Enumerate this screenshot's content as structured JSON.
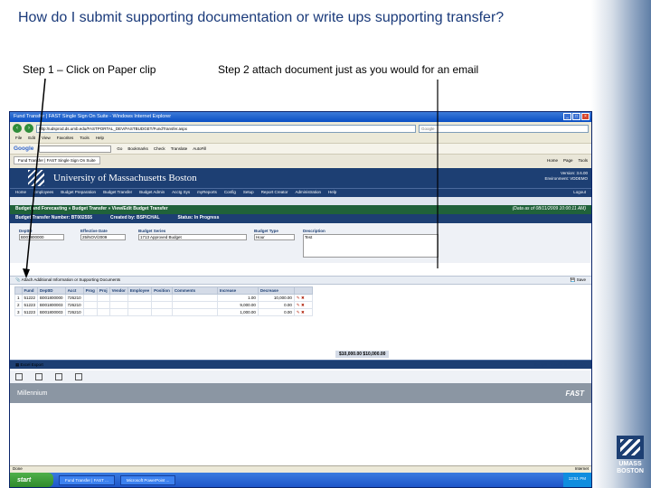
{
  "slide": {
    "title": "How do I submit supporting documentation or write ups supporting transfer?",
    "step1": "Step 1 – Click on Paper clip",
    "step2": "Step 2 attach document just as you would for an email"
  },
  "logo": {
    "line1": "UMASS",
    "line2": "BOSTON"
  },
  "browser": {
    "title": "Fund Transfer | FAST Single Sign On Suite - Windows Internet Explorer",
    "url": "http://udsprod.ds.umb.edu/FASTPORTAL_DEV/FASTBUDGET/FundTransfer.aspx",
    "search_placeholder": "Google",
    "menu": [
      "File",
      "Edit",
      "View",
      "Favorites",
      "Tools",
      "Help"
    ],
    "google_label": "Google",
    "google_buttons": [
      "Go",
      "Bookmarks",
      "Check",
      "Translate",
      "AutoFill"
    ],
    "tab": "Fund Transfer | FAST Single Sign On Suite",
    "tab_tools": [
      "Home",
      "Page",
      "Tools"
    ],
    "status_left": "Done",
    "status_right": "Internet"
  },
  "app": {
    "university": "University of Massachusetts Boston",
    "version_label": "Version:",
    "version_value": "3.6.00",
    "environment_label": "Environment:",
    "environment_value": "VDDEMO",
    "menu": [
      "Home",
      "Employees",
      "Budget Preparation",
      "Budget Transfer",
      "Budget Admin",
      "Acctg Sys",
      "myReports",
      "Config",
      "Setup",
      "Report Creator",
      "Administration",
      "Help"
    ],
    "logout": "Logout",
    "crumb1": "Budget and Forecasting » Budget Transfer » View/Edit Budget Transfer",
    "as_of": "(Data as of 08/11/2009 10:00:11 AM)",
    "bt_number_label": "Budget Transfer Number:",
    "bt_number": "BT002555",
    "created_by_label": "Created by:",
    "created_by": "BSPICHAL",
    "status_label": "Status:",
    "status": "In Progress",
    "fields": {
      "deptid_label": "DeptID",
      "deptid": "B001800000",
      "effective_label": "Effective Date",
      "effective": "25/NOV/2009",
      "series_label": "Budget Series",
      "series": "1713 Approved Budget",
      "type_label": "Budget Type",
      "type": "Hour",
      "desc_label": "Description",
      "desc": "Test"
    },
    "attach_text": "Attach Additional Information or Supporting Documents",
    "save": "Save",
    "grid": {
      "headers": [
        "",
        "Fund",
        "DeptID",
        "Acct",
        "Prog",
        "Proj",
        "Vendor",
        "Employee",
        "Position",
        "Comments",
        "Increase",
        "Decrease",
        ""
      ],
      "rows": [
        [
          "1",
          "51222",
          "B001800000",
          "726210",
          "",
          "",
          "",
          "",
          "",
          "",
          "1.00",
          "10,000.00"
        ],
        [
          "2",
          "51223",
          "B001800003",
          "726210",
          "",
          "",
          "",
          "",
          "",
          "",
          "9,000.00",
          "0.00"
        ],
        [
          "3",
          "51223",
          "B001800003",
          "726210",
          "",
          "",
          "",
          "",
          "",
          "",
          "1,000.00",
          "0.00"
        ]
      ]
    },
    "totals": "$10,000.00  $10,000.00",
    "export": "Excel Export",
    "balanced": "Budget Transfer is balanced.",
    "footer_left": "Millennium",
    "footer_right": "FAST"
  },
  "taskbar": {
    "start": "start",
    "items": [
      "Fund Transfer | FAST ...",
      "Microsoft PowerPoint ..."
    ],
    "clock": "12:51 PM"
  }
}
